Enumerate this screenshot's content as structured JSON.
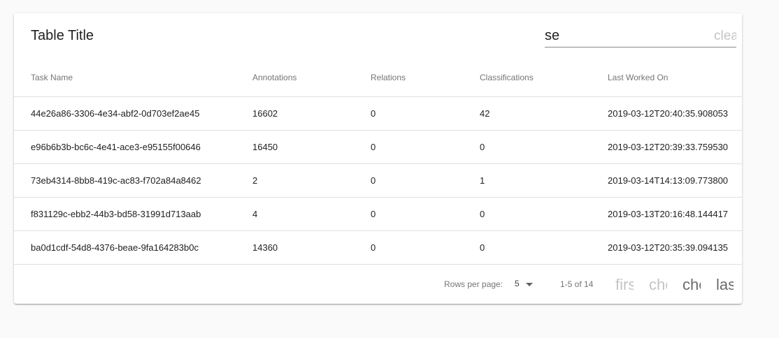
{
  "toolbar": {
    "title": "Table Title",
    "search_value": "se",
    "clear_label": "clear"
  },
  "table": {
    "columns": [
      "Task Name",
      "Annotations",
      "Relations",
      "Classifications",
      "Last Worked On"
    ],
    "rows": [
      [
        "44e26a86-3306-4e34-abf2-0d703ef2ae45",
        "16602",
        "0",
        "42",
        "2019-03-12T20:40:35.908053"
      ],
      [
        "e96b6b3b-bc6c-4e41-ace3-e95155f00646",
        "16450",
        "0",
        "0",
        "2019-03-12T20:39:33.759530"
      ],
      [
        "73eb4314-8bb8-419c-ac83-f702a84a8462",
        "2",
        "0",
        "1",
        "2019-03-14T14:13:09.773800"
      ],
      [
        "f831129c-ebb2-44b3-bd58-31991d713aab",
        "4",
        "0",
        "0",
        "2019-03-13T20:16:48.144417"
      ],
      [
        "ba0d1cdf-54d8-4376-beae-9fa164283b0c",
        "14360",
        "0",
        "0",
        "2019-03-12T20:35:39.094135"
      ]
    ]
  },
  "pagination": {
    "rows_per_page_label": "Rows per page:",
    "rows_per_page_value": "5",
    "range_text": "1-5 of 14",
    "first_label": "first_page",
    "prev_label": "chevron_left",
    "next_label": "chevron_right",
    "last_label": "last_page"
  }
}
